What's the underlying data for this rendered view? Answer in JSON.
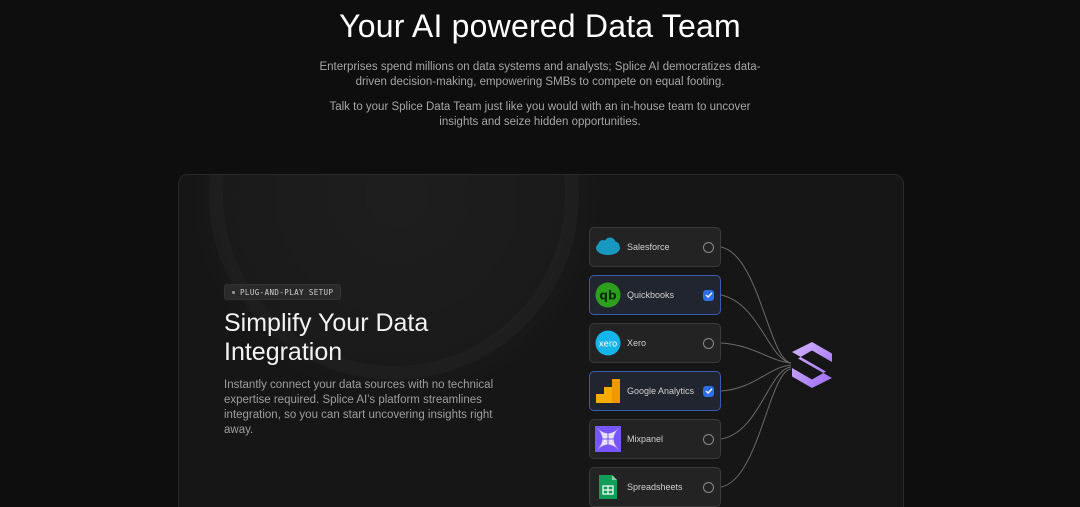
{
  "hero": {
    "title": "Your AI powered Data Team",
    "paragraph1_line1": "Enterprises spend millions on data systems and analysts; Splice AI democratizes data-",
    "paragraph1_line2": "driven decision-making, empowering SMBs to compete on equal footing.",
    "paragraph2_line1": "Talk to your Splice Data Team just like you would with an in-house team to uncover",
    "paragraph2_line2": "insights and seize hidden opportunities."
  },
  "feature": {
    "badge": "PLUG-AND-PLAY SETUP",
    "title": "Simplify Your Data Integration",
    "description": "Instantly connect your data sources with no technical expertise required. Splice AI's platform streamlines integration, so you can start uncovering insights right away."
  },
  "integrations": [
    {
      "label": "Salesforce",
      "icon": "salesforce-icon",
      "checked": false,
      "color": "#1798c1"
    },
    {
      "label": "Quickbooks",
      "icon": "quickbooks-icon",
      "checked": true,
      "color": "#2ca01c"
    },
    {
      "label": "Xero",
      "icon": "xero-icon",
      "checked": false,
      "color": "#13b5ea"
    },
    {
      "label": "Google Analytics",
      "icon": "google-analytics-icon",
      "checked": true,
      "color": "#f9ab00"
    },
    {
      "label": "Mixpanel",
      "icon": "mixpanel-icon",
      "checked": false,
      "color": "#7856ff"
    },
    {
      "label": "Spreadsheets",
      "icon": "spreadsheets-icon",
      "checked": false,
      "color": "#0f9d58"
    }
  ],
  "brand": {
    "logo": "splice-logo-icon",
    "accent": "#b78cf7"
  }
}
